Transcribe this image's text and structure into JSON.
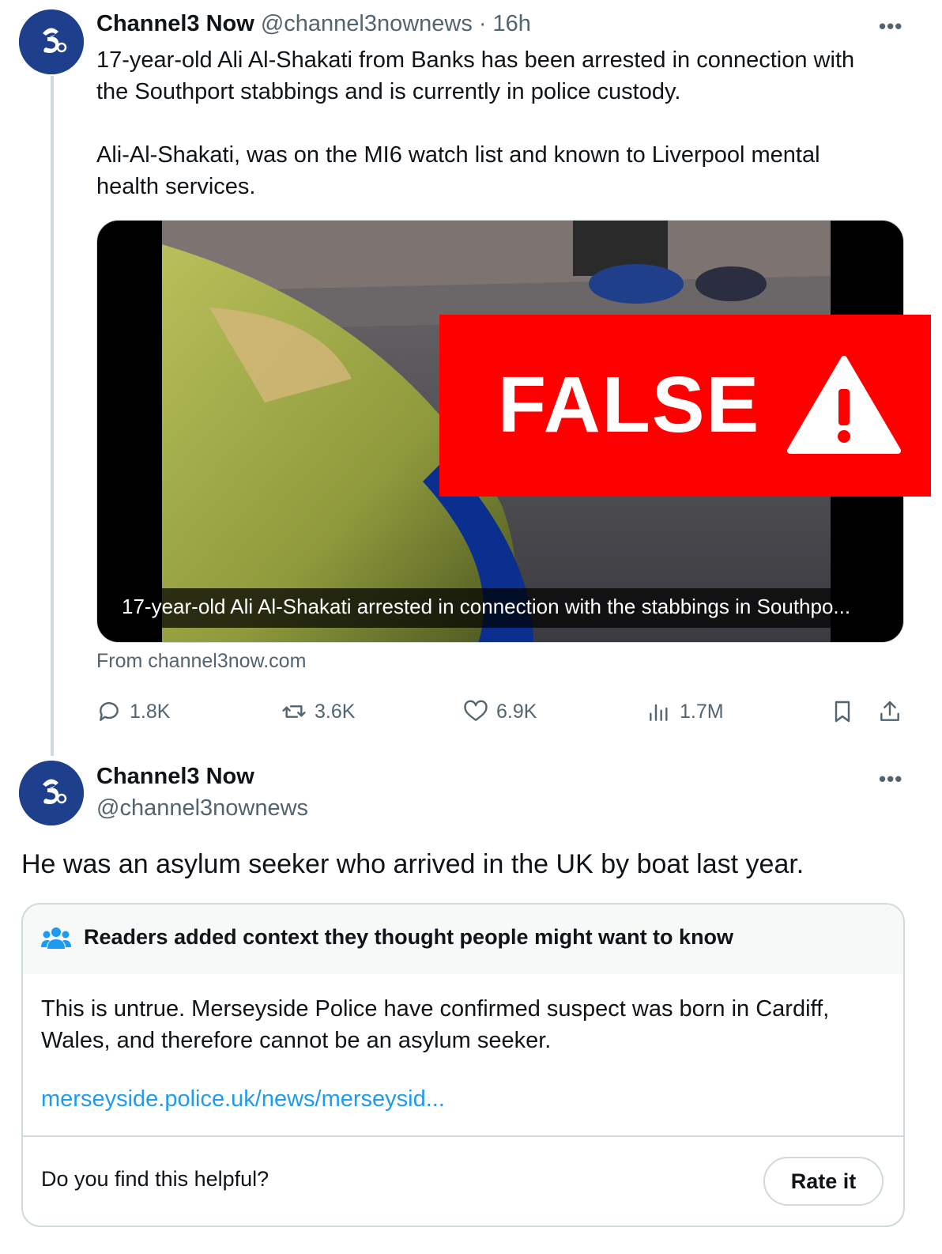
{
  "tweet1": {
    "author_name": "Channel3 Now",
    "handle": "@channel3nownews",
    "separator": "·",
    "time": "16h",
    "more": "•••",
    "text": "17-year-old Ali Al-Shakati from Banks has been arrested in connection with\nthe Southport stabbings and is currently in police custody.\n\nAli-Al-Shakati, was on the MI6 watch list and known to Liverpool mental\nhealth services.",
    "media_caption": "17-year-old Ali Al-Shakati arrested in connection with the stabbings in Southpo...",
    "overlay_label": "FALSE",
    "source": "From channel3now.com",
    "stats": {
      "replies": "1.8K",
      "reposts": "3.6K",
      "likes": "6.9K",
      "views": "1.7M"
    }
  },
  "tweet2": {
    "author_name": "Channel3 Now",
    "handle": "@channel3nownews",
    "more": "•••",
    "text": "He was an asylum seeker who arrived in the UK by boat last year."
  },
  "community_note": {
    "title": "Readers added context they thought people might want to know",
    "body": "This is untrue. Merseyside Police have confirmed suspect was born in Cardiff,\nWales, and therefore cannot be an asylum seeker.",
    "link": "merseyside.police.uk/news/merseysid...",
    "question": "Do you find this helpful?",
    "button": "Rate it"
  },
  "colors": {
    "accent_link": "#1d9bf0",
    "false_red": "#ff0000",
    "muted": "#536471",
    "avatar_bg": "#1d3f8c"
  },
  "icons": [
    "reply-icon",
    "repost-icon",
    "like-icon",
    "views-icon",
    "bookmark-icon",
    "share-icon",
    "people-icon",
    "warning-icon"
  ]
}
